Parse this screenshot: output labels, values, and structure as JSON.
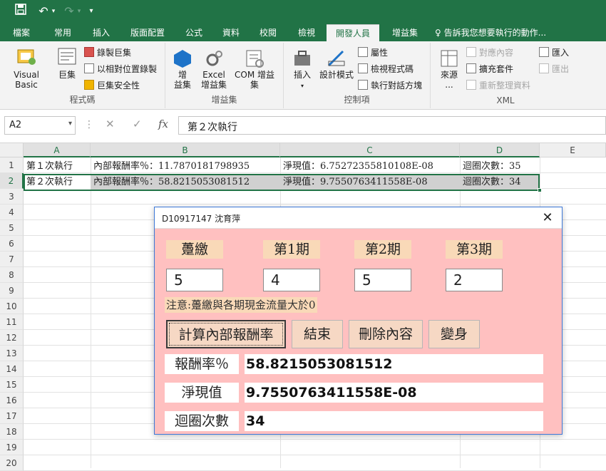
{
  "qat": {
    "save_icon": "save-icon",
    "undo_icon": "undo-icon",
    "redo_icon": "redo-icon",
    "customize_icon": "customize-icon"
  },
  "tabs": [
    {
      "label": "檔案"
    },
    {
      "label": "常用"
    },
    {
      "label": "插入"
    },
    {
      "label": "版面配置"
    },
    {
      "label": "公式"
    },
    {
      "label": "資料"
    },
    {
      "label": "校閱"
    },
    {
      "label": "檢視"
    },
    {
      "label": "開發人員"
    },
    {
      "label": "增益集"
    },
    {
      "label": "告訴我您想要執行的動作..."
    }
  ],
  "ribbon": {
    "code": {
      "label": "程式碼",
      "visual_basic": "Visual Basic",
      "macros": "巨集",
      "record_macro": "錄製巨集",
      "relative_ref": "以相對位置錄製",
      "macro_security": "巨集安全性"
    },
    "addins": {
      "label": "增益集",
      "addins_btn_1": "增",
      "addins_btn_2": "益集",
      "excel_addins_1": "Excel",
      "excel_addins_2": "增益集",
      "com_addins": "COM 增益集"
    },
    "controls": {
      "label": "控制項",
      "insert": "插入",
      "design_mode": "設計模式",
      "properties": "屬性",
      "view_code": "檢視程式碼",
      "run_dialog": "執行對話方塊"
    },
    "xml": {
      "label": "XML",
      "source_1": "來源",
      "source_2": "...",
      "map_props": "對應內容",
      "expansion_packs": "擴充套件",
      "refresh_data": "重新整理資料",
      "import": "匯入",
      "export": "匯出"
    }
  },
  "formula_bar": {
    "name_box": "A2",
    "cancel": "✕",
    "enter": "✓",
    "fx": "fx",
    "content": "第２次執行"
  },
  "columns": [
    "A",
    "B",
    "C",
    "D",
    "E"
  ],
  "rows": [
    "1",
    "2",
    "3",
    "4",
    "5",
    "6",
    "7",
    "8",
    "9",
    "10",
    "11",
    "12",
    "13",
    "14",
    "15",
    "16",
    "17",
    "18",
    "19",
    "20"
  ],
  "cells": {
    "A1": "第１次執行",
    "B1": "內部報酬率％：11.7870181798935",
    "C1": "淨現值：6.75272355810108E-08",
    "D1": "迴圈次數：35",
    "A2": "第２次執行",
    "B2": "內部報酬率％：58.8215053081512",
    "C2": "淨現值：9.7550763411558E-08",
    "D2": "迴圈次數：34"
  },
  "dialog": {
    "title": "D10917147 沈育萍",
    "headers": [
      "躉繳",
      "第1期",
      "第2期",
      "第3期"
    ],
    "inputs": [
      "5",
      "4",
      "5",
      "2"
    ],
    "note": "注意:躉繳與各期現金流量大於0",
    "buttons": [
      "計算內部報酬率",
      "結束",
      "刪除內容",
      "變身"
    ],
    "results": [
      {
        "label": "報酬率％",
        "value": "58.8215053081512"
      },
      {
        "label": "淨現值",
        "value": "9.7550763411558E-08"
      },
      {
        "label": "迴圈次數",
        "value": "34"
      }
    ]
  }
}
